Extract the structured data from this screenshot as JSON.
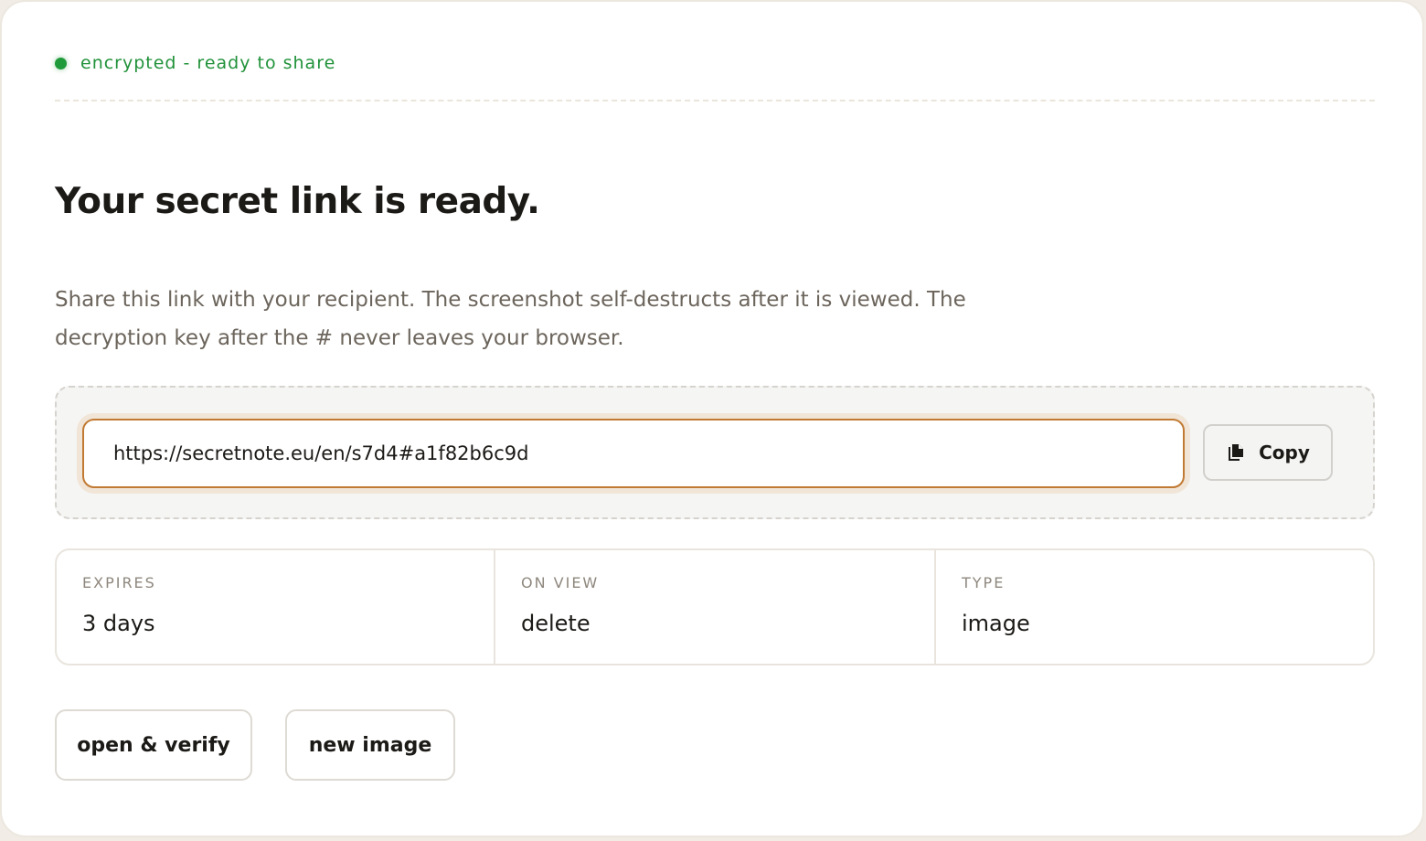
{
  "status": {
    "text": "encrypted - ready to share",
    "color": "#21923a"
  },
  "title": "Your secret link is ready.",
  "description": "Share this link with your recipient. The screenshot self-destructs after it is viewed. The decryption key after the # never leaves your browser.",
  "link": {
    "value": "https://secretnote.eu/en/s7d4#a1f82b6c9d",
    "copy_label": "Copy",
    "copy_icon": "copy-icon",
    "accent": "#c17a33"
  },
  "meta": [
    {
      "label": "EXPIRES",
      "value": "3 days"
    },
    {
      "label": "ON VIEW",
      "value": "delete"
    },
    {
      "label": "TYPE",
      "value": "image"
    }
  ],
  "actions": {
    "open_verify": "open & verify",
    "new_image": "new image"
  }
}
